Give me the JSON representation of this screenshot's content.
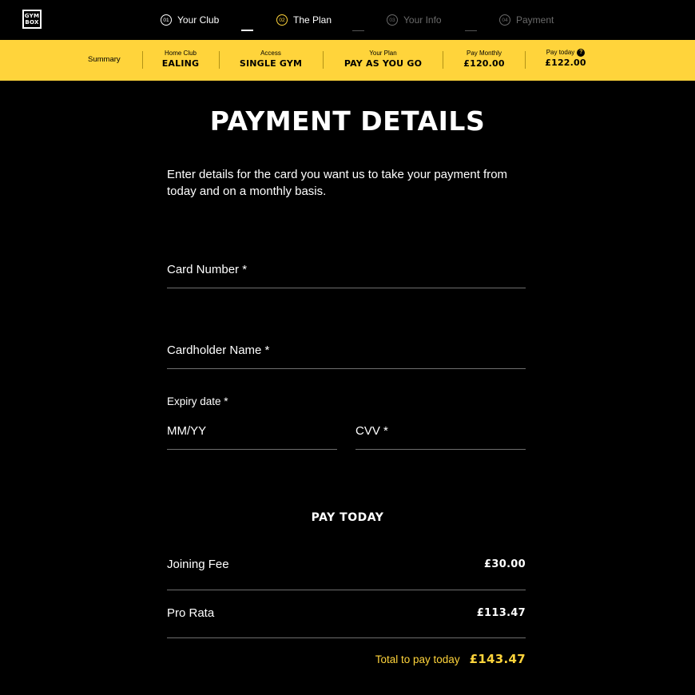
{
  "brand": {
    "logo_line1": "GYM",
    "logo_line2": "BOX"
  },
  "steps": [
    {
      "num": "01",
      "label": "Your Club"
    },
    {
      "num": "02",
      "label": "The Plan"
    },
    {
      "num": "03",
      "label": "Your Info"
    },
    {
      "num": "04",
      "label": "Payment"
    }
  ],
  "summary": {
    "label": "Summary",
    "home_club": {
      "key": "Home Club",
      "value": "EALING"
    },
    "access": {
      "key": "Access",
      "value": "SINGLE GYM"
    },
    "plan": {
      "key": "Your Plan",
      "value": "PAY AS YOU GO"
    },
    "monthly": {
      "key": "Pay Monthly",
      "value": "£120.00"
    },
    "today": {
      "key": "Pay today",
      "value": "£122.00",
      "help": "?"
    }
  },
  "main": {
    "title": "PAYMENT DETAILS",
    "intro": "Enter details for the card you want us to take your payment from today and on a monthly basis.",
    "card_number_placeholder": "Card Number *",
    "cardholder_placeholder": "Cardholder Name *",
    "expiry_label": "Expiry date *",
    "expiry_placeholder": "MM/YY",
    "cvv_placeholder": "CVV *"
  },
  "pay_today": {
    "title": "PAY TODAY",
    "rows": [
      {
        "label": "Joining Fee",
        "amount": "£30.00"
      },
      {
        "label": "Pro Rata",
        "amount": "£113.47"
      }
    ],
    "total_label": "Total to pay today",
    "total_amount": "£143.47"
  },
  "colors": {
    "accent": "#ffd43b",
    "background": "#000000",
    "text": "#ffffff",
    "muted": "#6a6a6a"
  }
}
